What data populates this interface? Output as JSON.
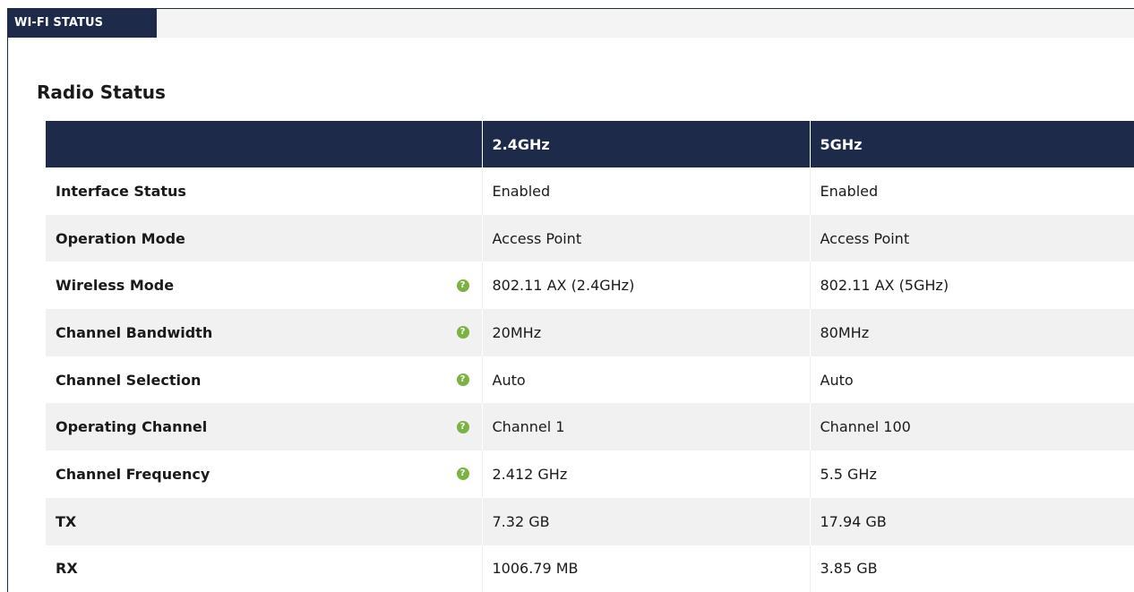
{
  "tab": {
    "title": "WI-FI STATUS"
  },
  "section": {
    "title": "Radio Status"
  },
  "table": {
    "headers": [
      "",
      "2.4GHz",
      "5GHz"
    ],
    "rows": [
      {
        "label": "Interface Status",
        "help": false,
        "v24": "Enabled",
        "v5": "Enabled"
      },
      {
        "label": "Operation Mode",
        "help": false,
        "v24": "Access Point",
        "v5": "Access Point"
      },
      {
        "label": "Wireless Mode",
        "help": true,
        "v24": "802.11 AX (2.4GHz)",
        "v5": "802.11 AX (5GHz)"
      },
      {
        "label": "Channel Bandwidth",
        "help": true,
        "v24": "20MHz",
        "v5": "80MHz"
      },
      {
        "label": "Channel Selection",
        "help": true,
        "v24": "Auto",
        "v5": "Auto"
      },
      {
        "label": "Operating Channel",
        "help": true,
        "v24": "Channel 1",
        "v5": "Channel 100"
      },
      {
        "label": "Channel Frequency",
        "help": true,
        "v24": "2.412 GHz",
        "v5": "5.5 GHz"
      },
      {
        "label": "TX",
        "help": false,
        "v24": "7.32 GB",
        "v5": "17.94 GB"
      },
      {
        "label": "RX",
        "help": false,
        "v24": "1006.79 MB",
        "v5": "3.85 GB"
      }
    ]
  },
  "help_icon": {
    "glyph": "?",
    "name": "question-mark-icon",
    "color": "#7ab341"
  },
  "colors": {
    "header_bg": "#1e2a4a",
    "stripe": "#f1f1f1"
  }
}
